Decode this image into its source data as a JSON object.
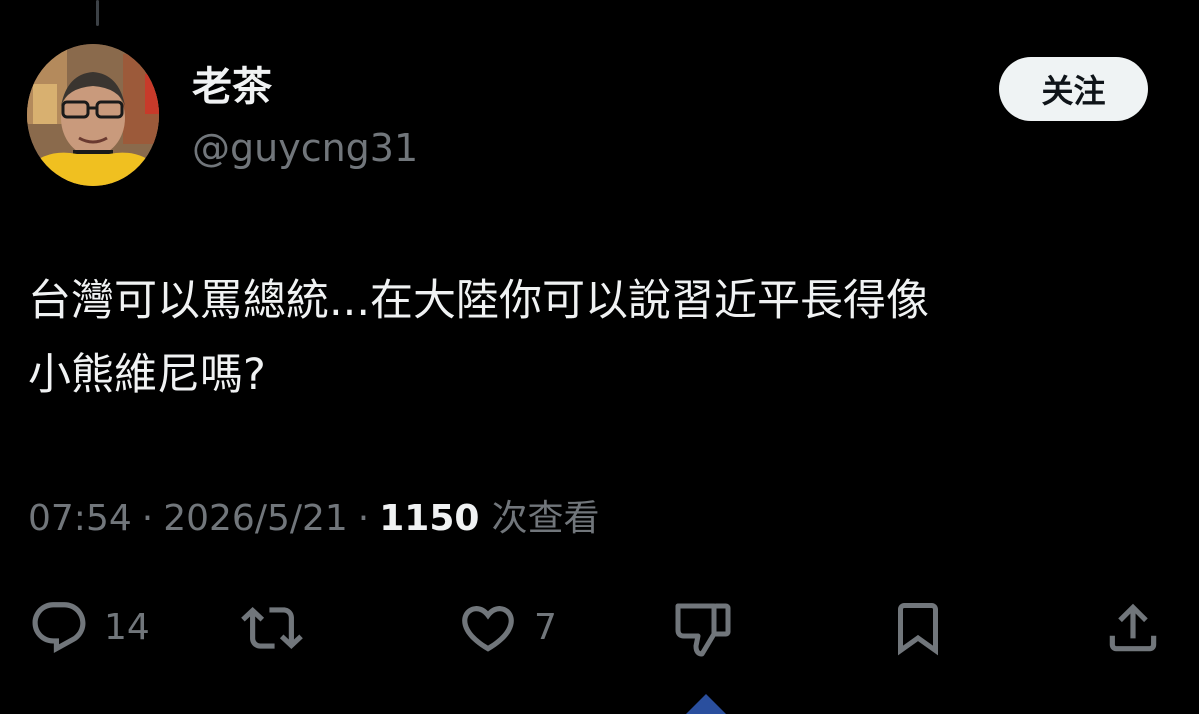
{
  "author": {
    "display_name": "老茶",
    "handle": "@guycng31"
  },
  "follow_button": {
    "label": "关注"
  },
  "tweet": {
    "lines": [
      "台灣可以罵總統...在大陸你可以說習近平長得像",
      "小熊維尼嗎?"
    ]
  },
  "meta": {
    "time": "07:54",
    "separator": "·",
    "date": "2026/5/21",
    "views_count": "1150",
    "views_label": "次查看"
  },
  "actions": {
    "reply": {
      "icon": "reply-icon",
      "count": "14"
    },
    "retweet": {
      "icon": "retweet-icon"
    },
    "like": {
      "icon": "heart-icon",
      "count": "7"
    },
    "dislike": {
      "icon": "thumbs-down-icon"
    },
    "bookmark": {
      "icon": "bookmark-icon"
    },
    "share": {
      "icon": "share-icon"
    }
  },
  "colors": {
    "background": "#000000",
    "text_primary": "#e7e9ea",
    "text_secondary": "#71767b",
    "follow_bg": "#eff3f4",
    "follow_text": "#0f1419"
  }
}
